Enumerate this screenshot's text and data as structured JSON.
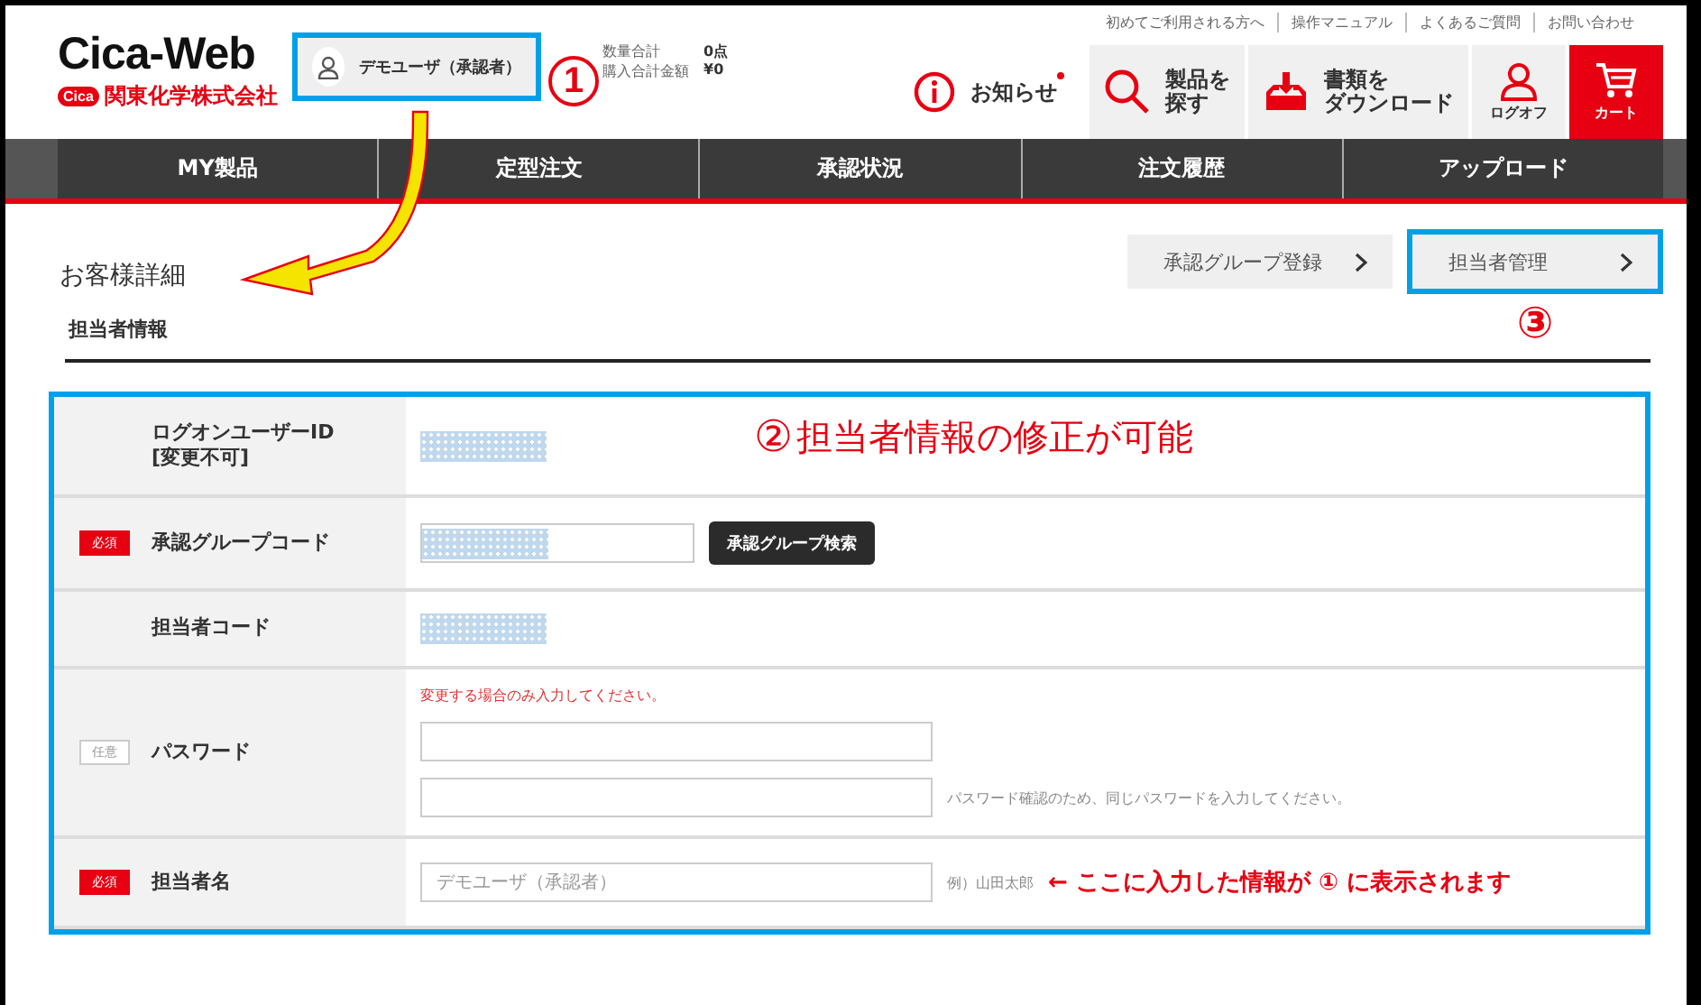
{
  "header": {
    "logo": {
      "title": "Cica-Web",
      "mark": "Cica",
      "company": "関東化学株式会社"
    },
    "user_box": {
      "name": "デモユーザ（承認者）",
      "callout": "1"
    },
    "summary": [
      {
        "label": "数量合計",
        "value": "0点"
      },
      {
        "label": "購入合計金額",
        "value": "¥0"
      }
    ],
    "top_links": [
      "初めてご利用される方へ",
      "操作マニュアル",
      "よくあるご質問",
      "お問い合わせ"
    ],
    "actions": [
      {
        "kind": "notice",
        "lines": [
          "お知らせ"
        ],
        "unread": true
      },
      {
        "kind": "search",
        "lines": [
          "製品を",
          "探す"
        ]
      },
      {
        "kind": "download",
        "lines": [
          "書類を",
          "ダウンロード"
        ]
      },
      {
        "kind": "logoff",
        "lines": [
          "ログオフ"
        ]
      },
      {
        "kind": "cart",
        "lines": [
          "カート"
        ]
      }
    ]
  },
  "nav": [
    "MY製品",
    "定型注文",
    "承認状況",
    "注文履歴",
    "アップロード"
  ],
  "page_title": "お客様詳細",
  "page_buttons": [
    {
      "label": "承認グループ登録",
      "highlighted": false
    },
    {
      "label": "担当者管理",
      "highlighted": true,
      "callout": "③"
    }
  ],
  "section_title": "担当者情報",
  "form": {
    "callout": {
      "number": "②",
      "text": "担当者情報の修正が可能"
    },
    "rows": [
      {
        "kind": "masked",
        "label": "ログオンユーザーID",
        "sublabel": "[変更不可]"
      },
      {
        "kind": "masked_input",
        "label": "承認グループコード",
        "badge": {
          "kind": "required",
          "text": "必須"
        },
        "button": "承認グループ検索"
      },
      {
        "kind": "masked",
        "label": "担当者コード"
      },
      {
        "kind": "password",
        "label": "パスワード",
        "badge": {
          "kind": "optional",
          "text": "任意"
        },
        "note": "変更する場合のみ入力してください。",
        "confirm_hint": "パスワード確認のため、同じパスワードを入力してください。"
      },
      {
        "kind": "text_input",
        "label": "担当者名",
        "badge": {
          "kind": "required",
          "text": "必須"
        },
        "placeholder": "デモユーザ（承認者）",
        "hint": "例）山田太郎",
        "callout": "← ここに入力した情報が ① に表示されます"
      }
    ]
  }
}
